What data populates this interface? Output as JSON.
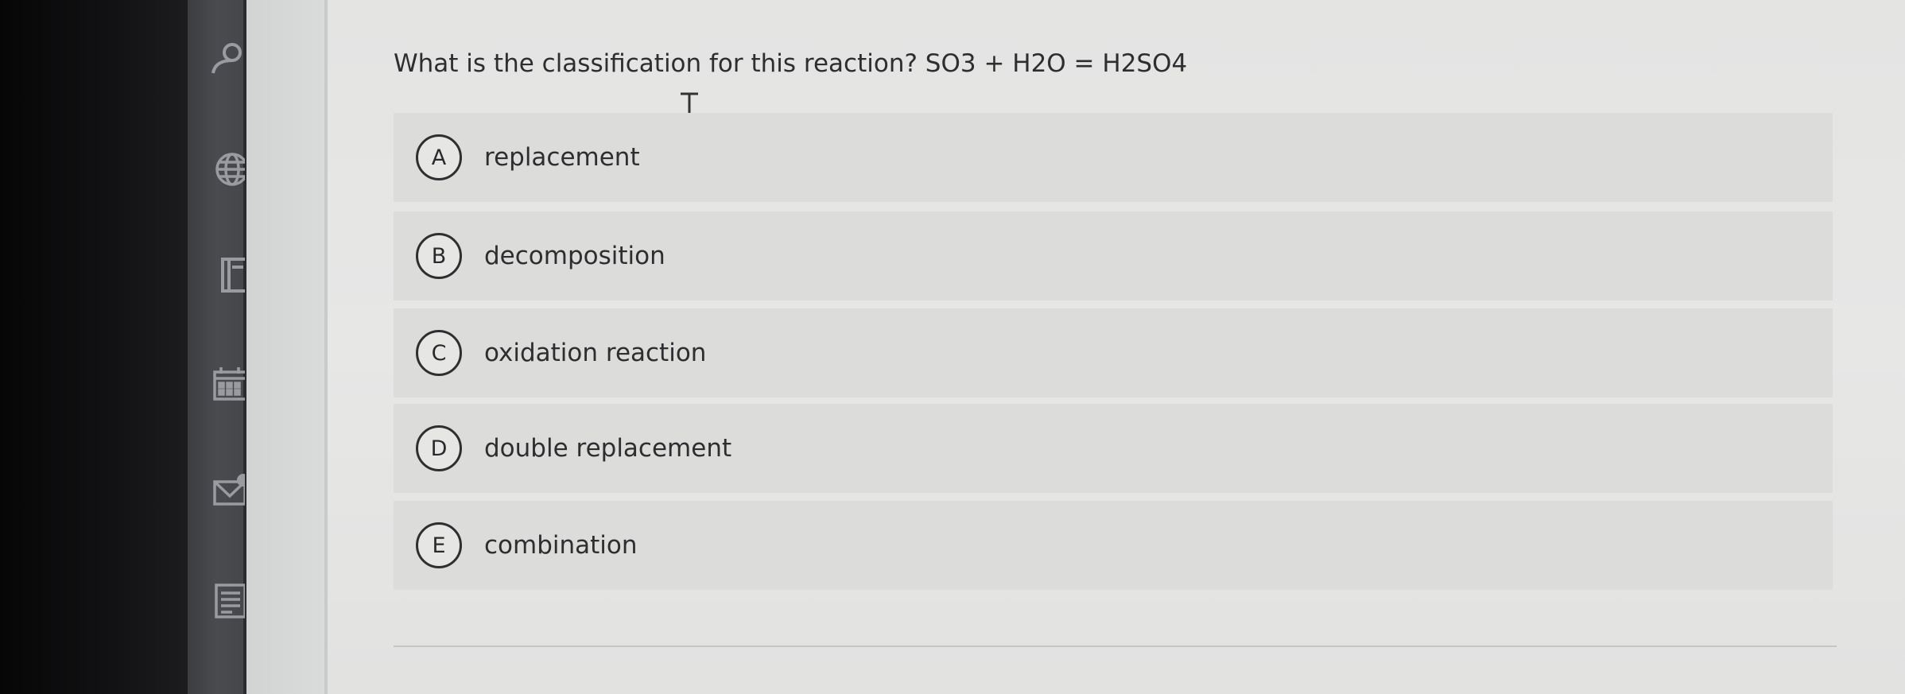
{
  "question": {
    "text": "What is the classification for this reaction? SO3 + H2O = H2SO4"
  },
  "options": [
    {
      "letter": "A",
      "text": "replacement"
    },
    {
      "letter": "B",
      "text": "decomposition"
    },
    {
      "letter": "C",
      "text": "oxidation reaction"
    },
    {
      "letter": "D",
      "text": "double replacement"
    },
    {
      "letter": "E",
      "text": "combination"
    }
  ],
  "sidebar": {
    "icons": [
      "user-icon",
      "globe-icon",
      "book-icon",
      "calendar-icon",
      "mail-icon",
      "document-icon"
    ]
  }
}
